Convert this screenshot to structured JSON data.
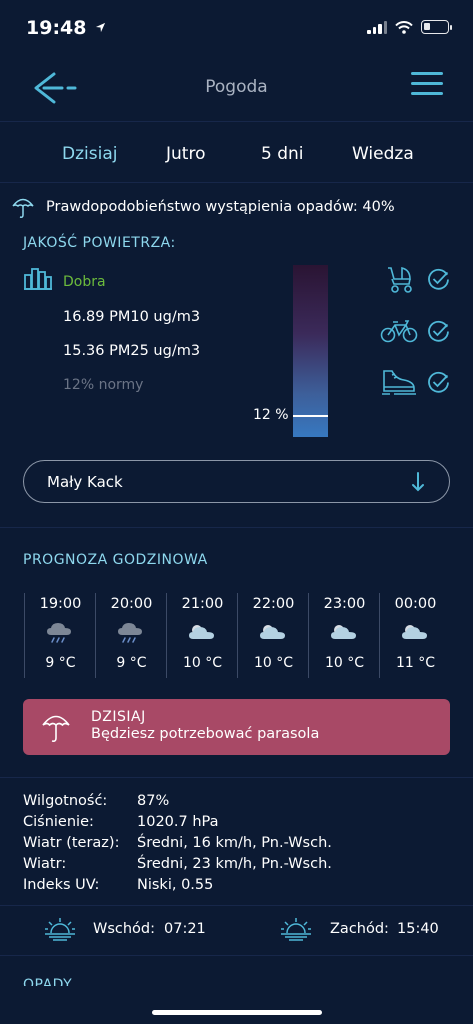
{
  "status_bar": {
    "time": "19:48"
  },
  "header": {
    "title": "Pogoda"
  },
  "tabs": [
    {
      "label": "Dzisiaj",
      "active": true
    },
    {
      "label": "Jutro",
      "active": false
    },
    {
      "label": "5 dni",
      "active": false
    },
    {
      "label": "Wiedza",
      "active": false
    }
  ],
  "precipitation": {
    "text": "Prawdopodobieństwo wystąpienia opadów: 40%"
  },
  "air_quality": {
    "title": "JAKOŚĆ POWIETRZA:",
    "quality": "Dobra",
    "pm10": "16.89  PM10  ug/m3",
    "pm25": "15.36  PM25 ug/m3",
    "norm": "12% normy",
    "bar_label": "12 %",
    "bar_fraction": 0.12,
    "activities": [
      "stroller-icon",
      "bicycle-icon",
      "shoe-icon"
    ]
  },
  "location": {
    "label": "Mały Kack"
  },
  "hourly": {
    "title": "PROGNOZA GODZINOWA",
    "items": [
      {
        "time": "19:00",
        "icon": "rain-cloud-icon",
        "temp": "9 °C"
      },
      {
        "time": "20:00",
        "icon": "rain-cloud-icon",
        "temp": "9 °C"
      },
      {
        "time": "21:00",
        "icon": "cloud-icon",
        "temp": "10 °C"
      },
      {
        "time": "22:00",
        "icon": "cloud-icon",
        "temp": "10 °C"
      },
      {
        "time": "23:00",
        "icon": "cloud-icon",
        "temp": "10 °C"
      },
      {
        "time": "00:00",
        "icon": "cloud-icon",
        "temp": "11 °C"
      }
    ]
  },
  "alert": {
    "title": "DZISIAJ",
    "text": "Będziesz potrzebować parasola"
  },
  "details": [
    {
      "label": "Wilgotność:",
      "value": "87%"
    },
    {
      "label": "Ciśnienie:",
      "value": "1020.7 hPa"
    },
    {
      "label": "Wiatr (teraz):",
      "value": "Średni, 16 km/h, Pn.-Wsch."
    },
    {
      "label": "Wiatr:",
      "value": "Średni, 23 km/h, Pn.-Wsch."
    },
    {
      "label": "Indeks UV:",
      "value": "Niski, 0.55"
    }
  ],
  "sun": {
    "sunrise_label": "Wschód:",
    "sunrise": "07:21",
    "sunset_label": "Zachód:",
    "sunset": "15:40"
  },
  "next_section": {
    "title": "OPADY"
  },
  "colors": {
    "background": "#0c1a33",
    "accent": "#8ed8ee",
    "alert": "#a84966",
    "good": "#6cbb3c"
  }
}
